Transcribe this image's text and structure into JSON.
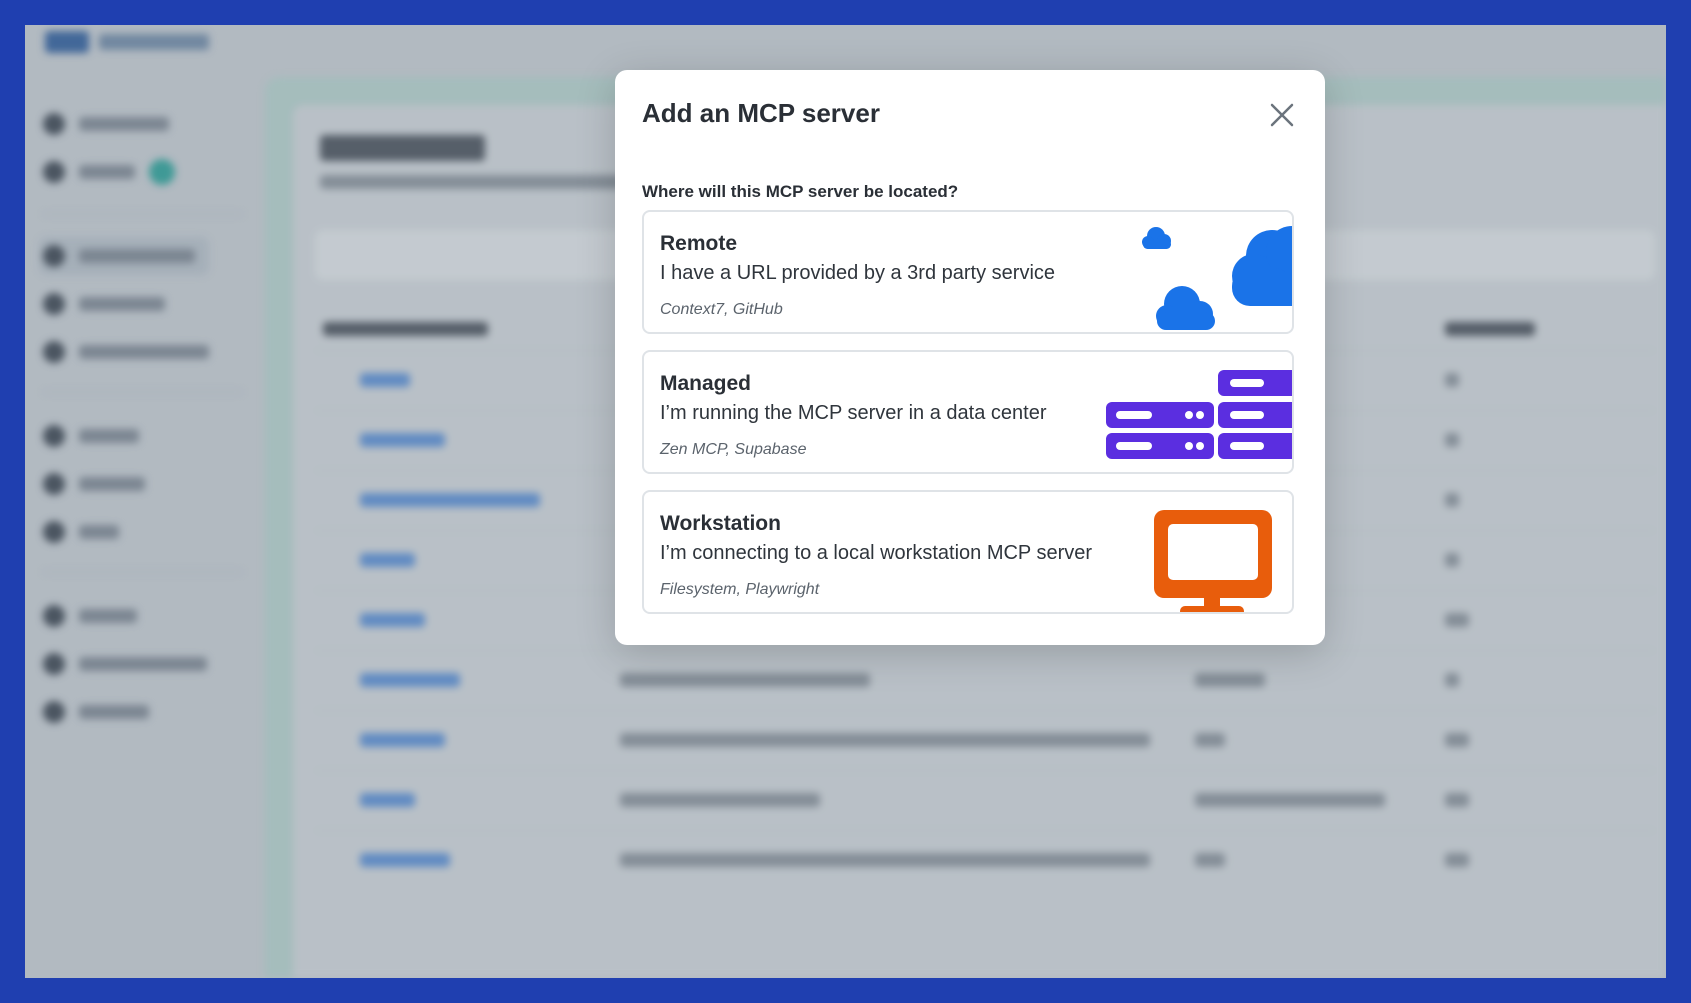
{
  "modal": {
    "title": "Add an MCP server",
    "close_icon": "close-icon",
    "question": "Where will this MCP server be located?",
    "options": [
      {
        "title": "Remote",
        "description": "I have a URL provided by a 3rd party service",
        "examples": "Context7, GitHub",
        "icon": "cloud-icon",
        "color": "#1a73e8"
      },
      {
        "title": "Managed",
        "description": "I’m running the MCP server in a data center",
        "examples": "Zen MCP, Supabase",
        "icon": "server-rack-icon",
        "color": "#5b2ee0"
      },
      {
        "title": "Workstation",
        "description": "I’m connecting to a local workstation MCP server",
        "examples": "Filesystem, Playwright",
        "icon": "monitor-icon",
        "color": "#e85d0c"
      }
    ]
  },
  "colors": {
    "frame_border": "#1f3fb0",
    "option_border": "#dfe3e7"
  }
}
